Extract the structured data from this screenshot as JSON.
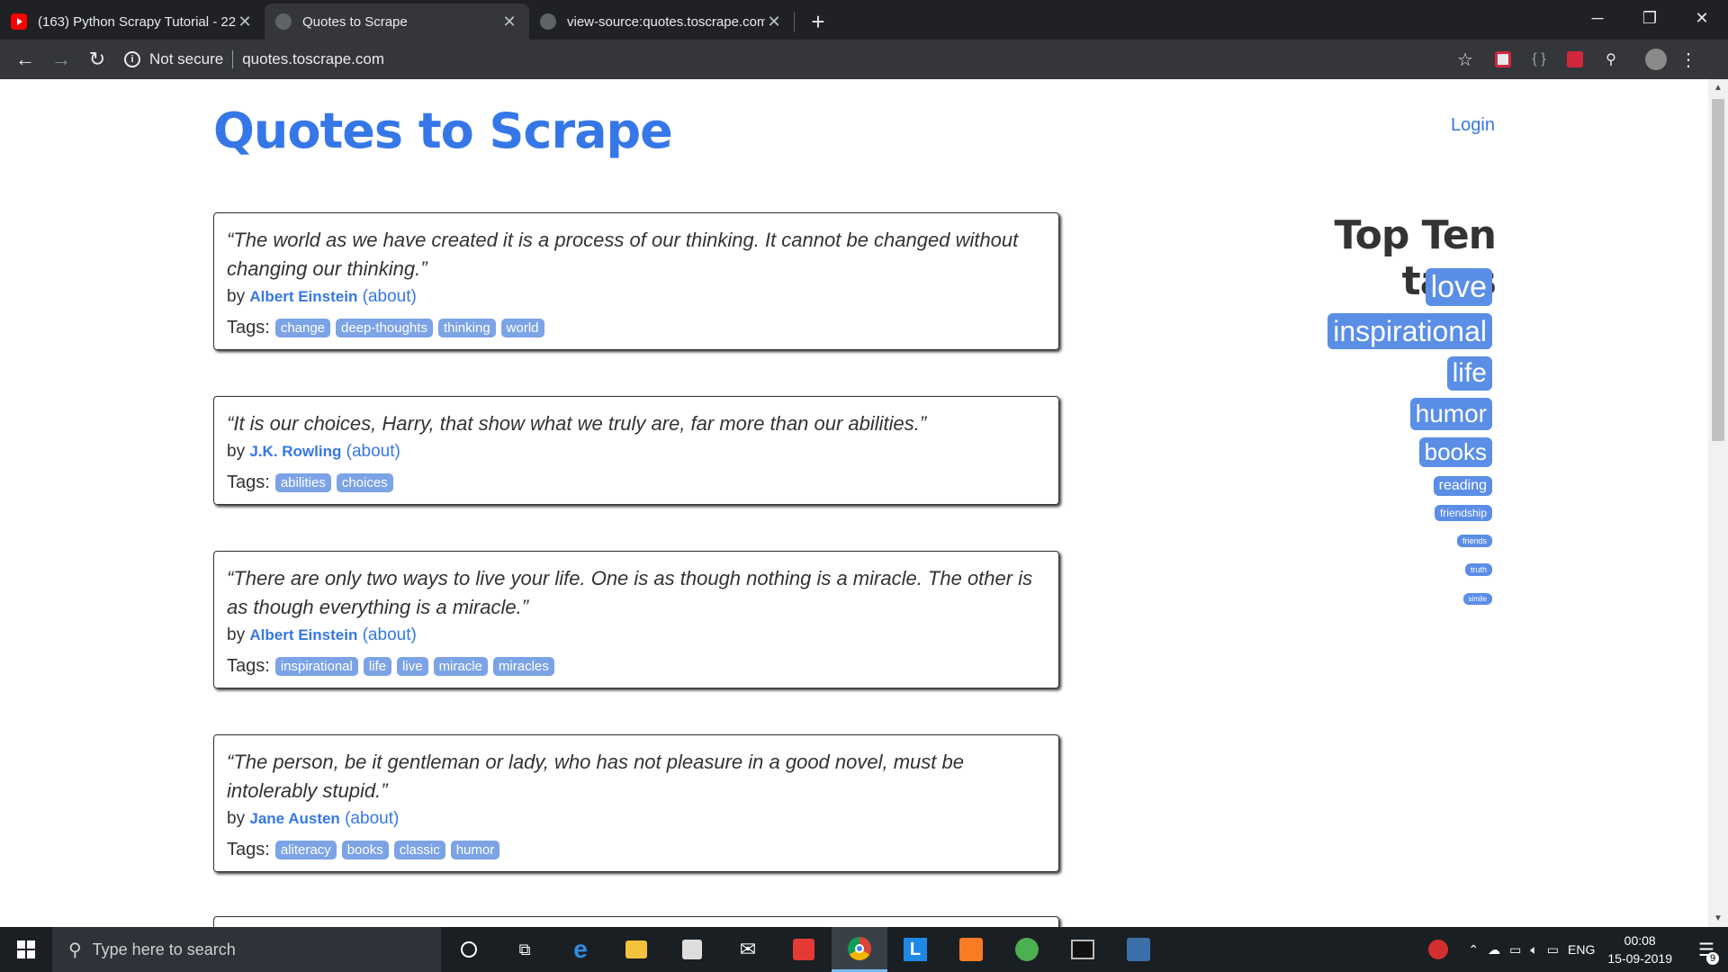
{
  "browser": {
    "tabs": [
      {
        "title": "(163) Python Scrapy Tutorial - 22",
        "icon": "youtube-icon",
        "active": false
      },
      {
        "title": "Quotes to Scrape",
        "icon": "globe-icon",
        "active": true
      },
      {
        "title": "view-source:quotes.toscrape.com",
        "icon": "globe-icon",
        "active": false
      }
    ],
    "new_tab": "+",
    "security_label": "Not secure",
    "url": "quotes.toscrape.com"
  },
  "site": {
    "title": "Quotes to Scrape",
    "login_label": "Login"
  },
  "quotes": [
    {
      "text": "“The world as we have created it is a process of our thinking. It cannot be changed without changing our thinking.”",
      "by": "by",
      "author": "Albert Einstein",
      "about": "(about)",
      "tags_label": "Tags:",
      "tags": [
        "change",
        "deep-thoughts",
        "thinking",
        "world"
      ]
    },
    {
      "text": "“It is our choices, Harry, that show what we truly are, far more than our abilities.”",
      "by": "by",
      "author": "J.K. Rowling",
      "about": "(about)",
      "tags_label": "Tags:",
      "tags": [
        "abilities",
        "choices"
      ]
    },
    {
      "text": "“There are only two ways to live your life. One is as though nothing is a miracle. The other is as though everything is a miracle.”",
      "by": "by",
      "author": "Albert Einstein",
      "about": "(about)",
      "tags_label": "Tags:",
      "tags": [
        "inspirational",
        "life",
        "live",
        "miracle",
        "miracles"
      ]
    },
    {
      "text": "“The person, be it gentleman or lady, who has not pleasure in a good novel, must be intolerably stupid.”",
      "by": "by",
      "author": "Jane Austen",
      "about": "(about)",
      "tags_label": "Tags:",
      "tags": [
        "aliteracy",
        "books",
        "classic",
        "humor"
      ]
    }
  ],
  "sidebar": {
    "title": "Top Ten tags",
    "tags": [
      {
        "label": "love"
      },
      {
        "label": "inspirational"
      },
      {
        "label": "life"
      },
      {
        "label": "humor"
      },
      {
        "label": "books"
      },
      {
        "label": "reading"
      },
      {
        "label": "friendship"
      },
      {
        "label": "friends"
      },
      {
        "label": "truth"
      },
      {
        "label": "simile"
      }
    ]
  },
  "taskbar": {
    "search_placeholder": "Type here to search",
    "language": "ENG",
    "time": "00:08",
    "date": "15-09-2019",
    "notification_count": "9"
  },
  "colors": {
    "link": "#3677e8",
    "tag_bg": "#7ca3e6",
    "cloud_tag_bg": "#5b8ee6"
  }
}
